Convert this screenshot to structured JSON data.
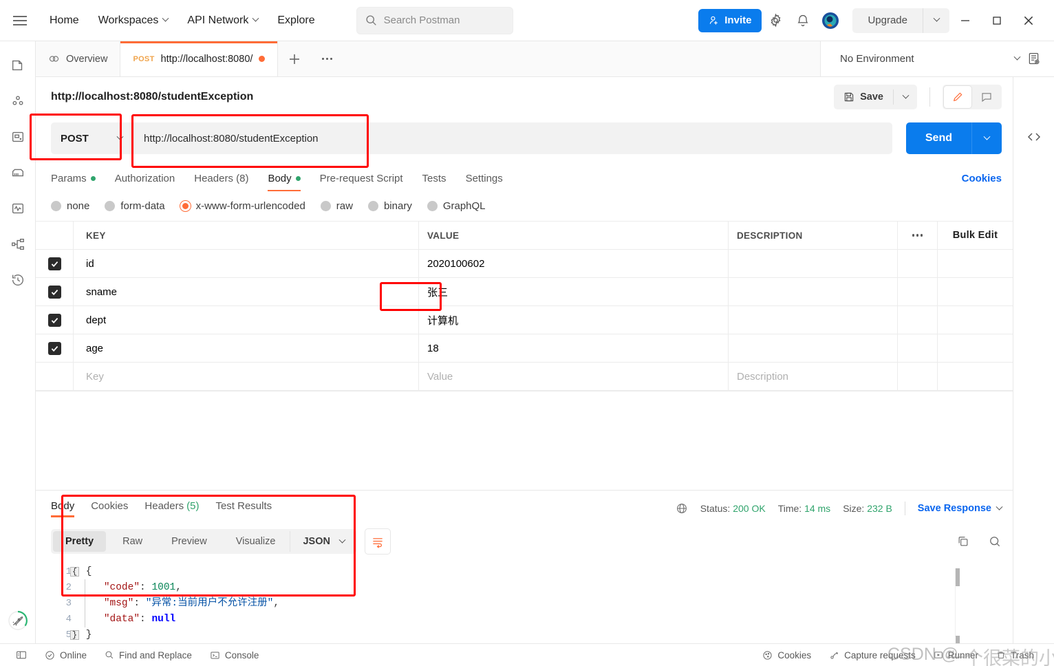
{
  "topbar": {
    "menu_icon": "hamburger-icon",
    "nav": [
      {
        "label": "Home",
        "caret": false
      },
      {
        "label": "Workspaces",
        "caret": true
      },
      {
        "label": "API Network",
        "caret": true
      },
      {
        "label": "Explore",
        "caret": false
      }
    ],
    "search": {
      "placeholder": "Search Postman",
      "icon": "search-icon"
    },
    "invite_label": "Invite",
    "settings_icon": "gear-icon",
    "notifications_icon": "bell-icon",
    "account_icon": "avatar-icon",
    "upgrade_label": "Upgrade",
    "window": {
      "minimize": "—",
      "maximize": "□",
      "close": "✕"
    }
  },
  "sidebar": {
    "items": [
      {
        "name": "collections-icon"
      },
      {
        "name": "apis-icon"
      },
      {
        "name": "environments-icon"
      },
      {
        "name": "mock-servers-icon"
      },
      {
        "name": "monitors-icon"
      },
      {
        "name": "flows-icon"
      },
      {
        "name": "history-icon"
      }
    ],
    "bottom_icon": "rocket-icon"
  },
  "tabs": {
    "items": [
      {
        "label": "Overview",
        "method": "",
        "active": false,
        "icon": "overview-icon",
        "unsaved": false
      },
      {
        "label": "http://localhost:8080/",
        "method": "POST",
        "active": true,
        "icon": "",
        "unsaved": true
      }
    ],
    "new_tab": "+",
    "more": "•••"
  },
  "environment": {
    "selected": "No Environment",
    "eye_icon": "environment-quick-look-icon"
  },
  "request": {
    "title": "http://localhost:8080/studentException",
    "save_label": "Save",
    "edit_icon": "pencil-icon",
    "comment_icon": "comment-icon",
    "code_icon": "code-snippet-icon",
    "method": "POST",
    "url": "http://localhost:8080/studentException",
    "send_label": "Send",
    "tabs": [
      {
        "label": "Params",
        "dot": true,
        "active": false
      },
      {
        "label": "Authorization",
        "dot": false,
        "active": false
      },
      {
        "label": "Headers (8)",
        "dot": false,
        "active": false
      },
      {
        "label": "Body",
        "dot": true,
        "active": true
      },
      {
        "label": "Pre-request Script",
        "dot": false,
        "active": false
      },
      {
        "label": "Tests",
        "dot": false,
        "active": false
      },
      {
        "label": "Settings",
        "dot": false,
        "active": false
      }
    ],
    "cookies_link": "Cookies",
    "body_types": [
      {
        "label": "none",
        "selected": false
      },
      {
        "label": "form-data",
        "selected": false
      },
      {
        "label": "x-www-form-urlencoded",
        "selected": true
      },
      {
        "label": "raw",
        "selected": false
      },
      {
        "label": "binary",
        "selected": false
      },
      {
        "label": "GraphQL",
        "selected": false
      }
    ],
    "table": {
      "headers": {
        "key": "KEY",
        "value": "VALUE",
        "description": "DESCRIPTION"
      },
      "bulk_edit": "Bulk Edit",
      "rows": [
        {
          "checked": true,
          "key": "id",
          "value": "2020100602",
          "description": ""
        },
        {
          "checked": true,
          "key": "sname",
          "value": "张三",
          "description": ""
        },
        {
          "checked": true,
          "key": "dept",
          "value": "计算机",
          "description": ""
        },
        {
          "checked": true,
          "key": "age",
          "value": "18",
          "description": ""
        }
      ],
      "placeholder_row": {
        "key": "Key",
        "value": "Value",
        "description": "Description"
      }
    }
  },
  "response": {
    "tabs": [
      {
        "label": "Body",
        "count": "",
        "active": true
      },
      {
        "label": "Cookies",
        "count": "",
        "active": false
      },
      {
        "label": "Headers",
        "count": "(5)",
        "active": false
      },
      {
        "label": "Test Results",
        "count": "",
        "active": false
      }
    ],
    "status_label": "Status:",
    "status_value": "200 OK",
    "time_label": "Time:",
    "time_value": "14 ms",
    "size_label": "Size:",
    "size_value": "232 B",
    "save_response": "Save Response",
    "view_modes": [
      {
        "label": "Pretty",
        "active": true
      },
      {
        "label": "Raw",
        "active": false
      },
      {
        "label": "Preview",
        "active": false
      },
      {
        "label": "Visualize",
        "active": false
      }
    ],
    "format": "JSON",
    "wrap_icon": "wrap-lines-icon",
    "copy_icon": "copy-icon",
    "search_icon": "search-icon",
    "body_lines": [
      {
        "n": "1",
        "parts": [
          {
            "t": "{",
            "c": "k-brace"
          }
        ]
      },
      {
        "n": "2",
        "parts": [
          {
            "t": "    ",
            "c": "k-brace"
          },
          {
            "t": "\"code\"",
            "c": "k-str"
          },
          {
            "t": ": ",
            "c": "k-brace"
          },
          {
            "t": "1001",
            "c": "k-num"
          },
          {
            "t": ",",
            "c": "k-brace"
          }
        ]
      },
      {
        "n": "3",
        "parts": [
          {
            "t": "    ",
            "c": "k-brace"
          },
          {
            "t": "\"msg\"",
            "c": "k-str"
          },
          {
            "t": ": ",
            "c": "k-brace"
          },
          {
            "t": "\"异常:当前用户不允许注册\"",
            "c": "k-txt"
          },
          {
            "t": ",",
            "c": "k-brace"
          }
        ]
      },
      {
        "n": "4",
        "parts": [
          {
            "t": "    ",
            "c": "k-brace"
          },
          {
            "t": "\"data\"",
            "c": "k-str"
          },
          {
            "t": ": ",
            "c": "k-brace"
          },
          {
            "t": "null",
            "c": "k-null"
          }
        ]
      },
      {
        "n": "5",
        "parts": [
          {
            "t": "}",
            "c": "k-brace"
          }
        ]
      }
    ]
  },
  "statusbar": {
    "left": [
      {
        "label": "",
        "icon": "sidebar-toggle-icon"
      },
      {
        "label": "Online",
        "icon": "online-icon"
      },
      {
        "label": "Find and Replace",
        "icon": "search-icon"
      },
      {
        "label": "Console",
        "icon": "console-icon"
      }
    ],
    "right": [
      {
        "label": "Cookies",
        "icon": "cookie-icon"
      },
      {
        "label": "Capture requests",
        "icon": "capture-icon"
      },
      {
        "label": "Runner",
        "icon": "runner-icon"
      },
      {
        "label": "Trash",
        "icon": "trash-icon"
      }
    ]
  },
  "watermark": {
    "text1": "CSDN @",
    "text2": "一个很菜的小猪"
  },
  "colors": {
    "accent_orange": "#ff6c37",
    "blue": "#0a7ced",
    "green": "#30a46c",
    "annotation_red": "#ff0000"
  }
}
